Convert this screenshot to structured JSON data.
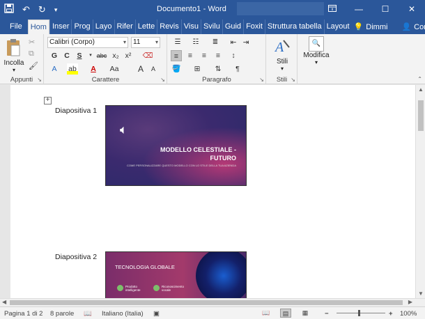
{
  "window": {
    "title_doc": "Documento1",
    "title_app": "Word",
    "title_sep": "-"
  },
  "qat": {
    "save_icon": "save-icon",
    "undo_icon": "undo-icon",
    "redo_icon": "redo-icon",
    "customize_icon": "customize-icon"
  },
  "tabs": [
    {
      "label": "File"
    },
    {
      "label": "Hom"
    },
    {
      "label": "Inser"
    },
    {
      "label": "Prog"
    },
    {
      "label": "Layo"
    },
    {
      "label": "Rifer"
    },
    {
      "label": "Lette"
    },
    {
      "label": "Revis"
    },
    {
      "label": "Visu"
    },
    {
      "label": "Svilu"
    },
    {
      "label": "Guid"
    },
    {
      "label": "Foxit"
    },
    {
      "label": "Struttura tabella"
    },
    {
      "label": "Layout"
    }
  ],
  "tabs_right": {
    "tell": "Dimmi",
    "share": "Condividi"
  },
  "ribbon": {
    "clipboard": {
      "paste": "Incolla",
      "group": "Appunti"
    },
    "font": {
      "name": "Calibri (Corpo)",
      "size": "11",
      "group": "Carattere",
      "bold": "G",
      "italic": "C",
      "underline": "S",
      "strike": "abc",
      "sub": "x₂",
      "sup": "x²",
      "case": "Aa",
      "grow": "A",
      "shrink": "A"
    },
    "paragraph": {
      "group": "Paragrafo"
    },
    "styles": {
      "label": "Stili",
      "group": "Stili"
    },
    "editing": {
      "label": "Modifica"
    }
  },
  "document": {
    "slides": [
      {
        "label": "Diapositiva 1",
        "title": "MODELLO CELESTIALE -",
        "title2": "FUTURO",
        "subtitle": "COME PERSONALIZZARE QUESTO MODELLO CON LO STILE DELLA TUA AZIENDA"
      },
      {
        "label": "Diapositiva 2",
        "title": "TECNOLOGIA GLOBALE",
        "item1": "Prodotto intelligente",
        "item2": "Riconoscimento vocale"
      }
    ]
  },
  "status": {
    "page": "Pagina 1 di 2",
    "words": "8 parole",
    "language": "Italiano (Italia)",
    "zoom": "100%",
    "zoom_fraction": 0.45
  }
}
